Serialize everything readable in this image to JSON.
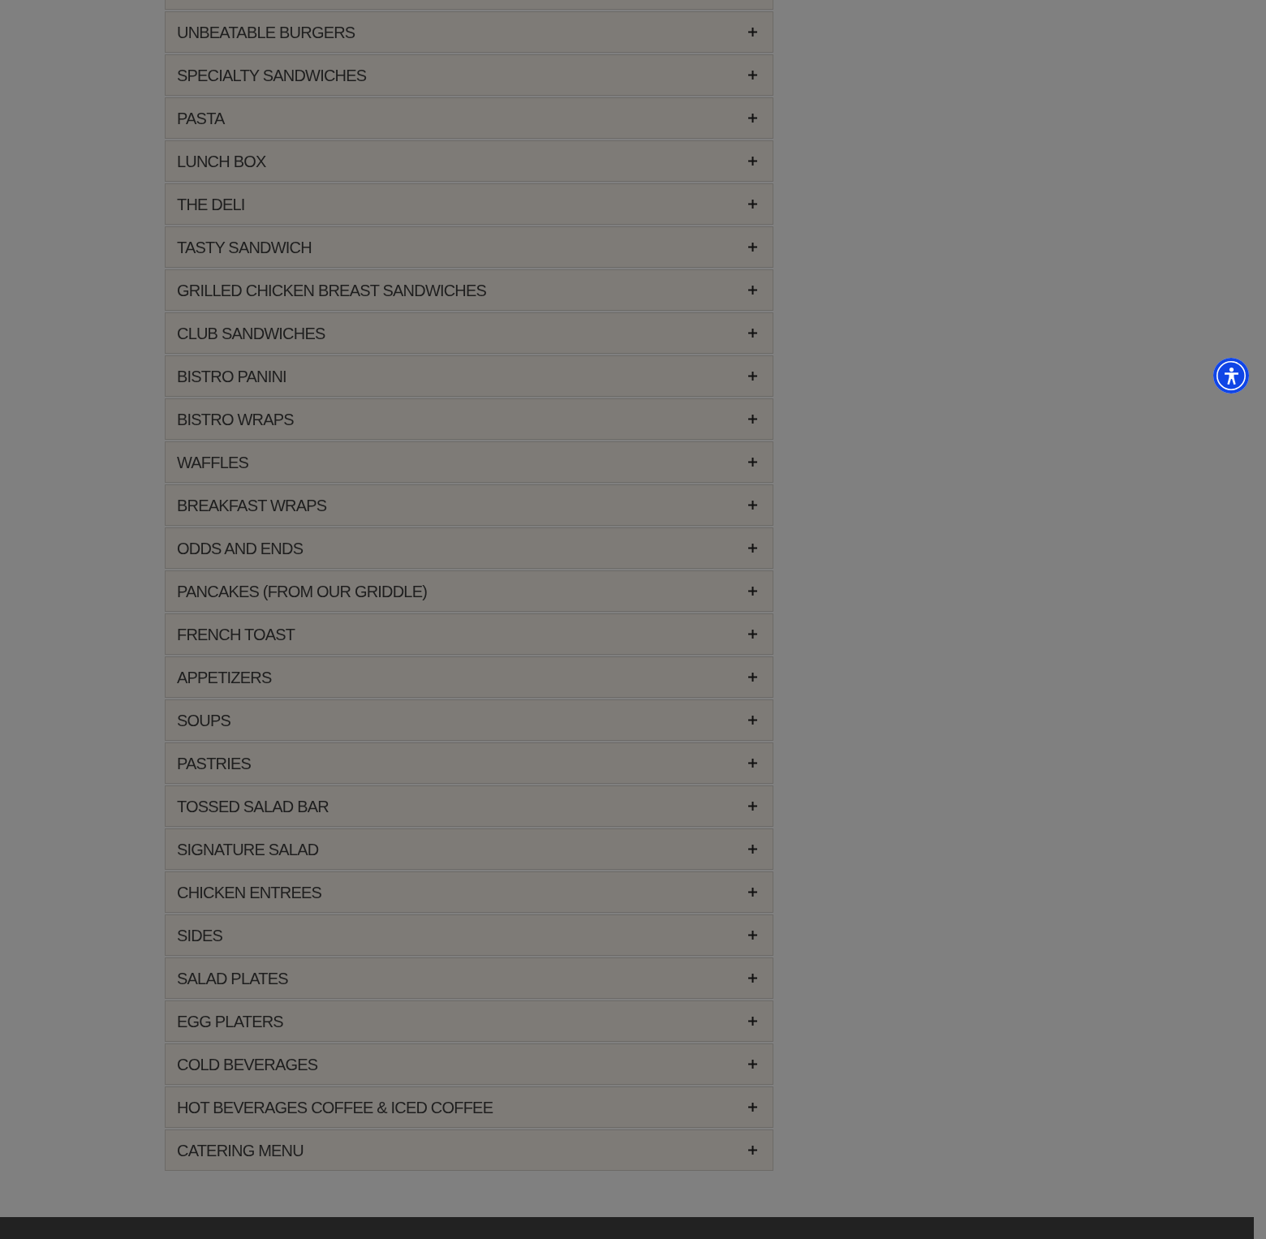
{
  "menu": {
    "categories": [
      {
        "label": "UNBEATABLE BURGERS",
        "expanded": false
      },
      {
        "label": "SPECIALTY SANDWICHES",
        "expanded": false
      },
      {
        "label": "PASTA",
        "expanded": false
      },
      {
        "label": "LUNCH BOX",
        "expanded": false
      },
      {
        "label": "THE DELI",
        "expanded": false
      },
      {
        "label": "TASTY SANDWICH",
        "expanded": false
      },
      {
        "label": "GRILLED CHICKEN BREAST SANDWICHES",
        "expanded": false
      },
      {
        "label": "CLUB SANDWICHES",
        "expanded": false
      },
      {
        "label": "BISTRO PANINI",
        "expanded": false
      },
      {
        "label": "BISTRO WRAPS",
        "expanded": false
      },
      {
        "label": "WAFFLES",
        "expanded": false
      },
      {
        "label": "BREAKFAST WRAPS",
        "expanded": false
      },
      {
        "label": "ODDS AND ENDS",
        "expanded": false
      },
      {
        "label": "PANCAKES (FROM OUR GRIDDLE)",
        "expanded": false
      },
      {
        "label": "FRENCH TOAST",
        "expanded": false
      },
      {
        "label": "APPETIZERS",
        "expanded": false
      },
      {
        "label": "SOUPS",
        "expanded": false
      },
      {
        "label": "PASTRIES",
        "expanded": false
      },
      {
        "label": "TOSSED SALAD BAR",
        "expanded": false
      },
      {
        "label": "SIGNATURE SALAD",
        "expanded": false
      },
      {
        "label": "CHICKEN ENTREES",
        "expanded": false
      },
      {
        "label": "SIDES",
        "expanded": false
      },
      {
        "label": "SALAD PLATES",
        "expanded": false
      },
      {
        "label": "EGG PLATERS",
        "expanded": false
      },
      {
        "label": "COLD BEVERAGES",
        "expanded": false
      },
      {
        "label": "HOT BEVERAGES COFFEE & ICED COFFEE",
        "expanded": false
      },
      {
        "label": "CATERING MENU",
        "expanded": false
      }
    ]
  }
}
